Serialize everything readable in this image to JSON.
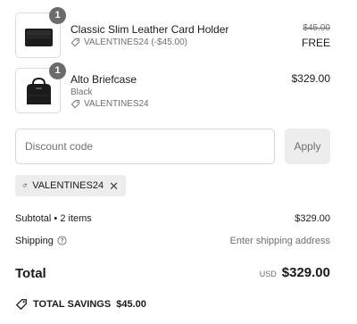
{
  "cart": {
    "items": [
      {
        "quantity": "1",
        "name": "Classic Slim Leather Card Holder",
        "discount": "VALENTINES24 (-$45.00)",
        "original_price": "$45.00",
        "price": "FREE",
        "image_icon": "card-holder-image"
      },
      {
        "quantity": "1",
        "name": "Alto Briefcase",
        "variant": "Black",
        "discount": "VALENTINES24",
        "price": "$329.00",
        "image_icon": "briefcase-image"
      }
    ]
  },
  "discount": {
    "placeholder": "Discount code",
    "apply_label": "Apply",
    "applied_code": "VALENTINES24",
    "remove_glyph": "✕"
  },
  "summary": {
    "subtotal_label": "Subtotal • 2 items",
    "subtotal_value": "$329.00",
    "shipping_label": "Shipping",
    "shipping_value": "Enter shipping address",
    "total_label": "Total",
    "currency": "USD",
    "total_value": "$329.00",
    "savings_label": "TOTAL SAVINGS",
    "savings_value": "$45.00"
  }
}
